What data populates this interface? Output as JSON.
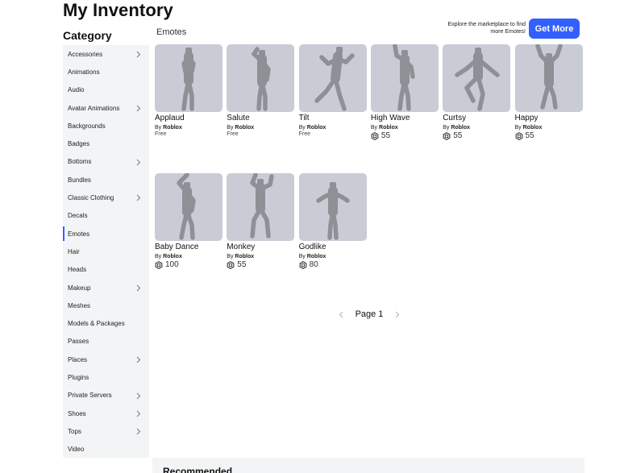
{
  "page": {
    "title": "My Inventory"
  },
  "sidebar": {
    "heading": "Category",
    "items": [
      {
        "label": "Accessories",
        "chevron": true
      },
      {
        "label": "Animations",
        "chevron": false
      },
      {
        "label": "Audio",
        "chevron": false
      },
      {
        "label": "Avatar Animations",
        "chevron": true
      },
      {
        "label": "Backgrounds",
        "chevron": false
      },
      {
        "label": "Badges",
        "chevron": false
      },
      {
        "label": "Bottoms",
        "chevron": true
      },
      {
        "label": "Bundles",
        "chevron": false
      },
      {
        "label": "Classic Clothing",
        "chevron": true
      },
      {
        "label": "Decals",
        "chevron": false
      },
      {
        "label": "Emotes",
        "chevron": false,
        "active": true
      },
      {
        "label": "Hair",
        "chevron": false
      },
      {
        "label": "Heads",
        "chevron": false
      },
      {
        "label": "Makeup",
        "chevron": true
      },
      {
        "label": "Meshes",
        "chevron": false
      },
      {
        "label": "Models & Packages",
        "chevron": false
      },
      {
        "label": "Passes",
        "chevron": false
      },
      {
        "label": "Places",
        "chevron": true
      },
      {
        "label": "Plugins",
        "chevron": false
      },
      {
        "label": "Private Servers",
        "chevron": true
      },
      {
        "label": "Shoes",
        "chevron": true
      },
      {
        "label": "Tops",
        "chevron": true
      },
      {
        "label": "Video",
        "chevron": false
      }
    ]
  },
  "main": {
    "section_label": "Emotes",
    "promo_text": "Explore the marketplace to find more Emotes!",
    "get_more_label": "Get More",
    "items": [
      {
        "name": "Applaud",
        "by": "By",
        "creator": "Roblox",
        "price": "Free",
        "robux": false,
        "pose": "applaud"
      },
      {
        "name": "Salute",
        "by": "By",
        "creator": "Roblox",
        "price": "Free",
        "robux": false,
        "pose": "salute"
      },
      {
        "name": "Tilt",
        "by": "By",
        "creator": "Roblox",
        "price": "Free",
        "robux": false,
        "pose": "tilt"
      },
      {
        "name": "High Wave",
        "by": "By",
        "creator": "Roblox",
        "price": "55",
        "robux": true,
        "pose": "wave"
      },
      {
        "name": "Curtsy",
        "by": "By",
        "creator": "Roblox",
        "price": "55",
        "robux": true,
        "pose": "curtsy"
      },
      {
        "name": "Happy",
        "by": "By",
        "creator": "Roblox",
        "price": "55",
        "robux": true,
        "pose": "happy"
      },
      {
        "name": "Baby Dance",
        "by": "By",
        "creator": "Roblox",
        "price": "100",
        "robux": true,
        "pose": "babydance"
      },
      {
        "name": "Monkey",
        "by": "By",
        "creator": "Roblox",
        "price": "55",
        "robux": true,
        "pose": "monkey"
      },
      {
        "name": "Godlike",
        "by": "By",
        "creator": "Roblox",
        "price": "80",
        "robux": true,
        "pose": "godlike"
      }
    ],
    "pager": {
      "label": "Page 1"
    }
  },
  "recommended": {
    "title": "Recommended"
  },
  "colors": {
    "accent": "#335fff",
    "thumb_bg": "#c9ccd5",
    "figure": "#8e9096",
    "sidebar_bg": "#f2f4f5"
  },
  "icons": {
    "price": "robux-icon",
    "expand": "chevron-right-icon",
    "prev": "chevron-left-icon",
    "next": "chevron-right-icon"
  }
}
